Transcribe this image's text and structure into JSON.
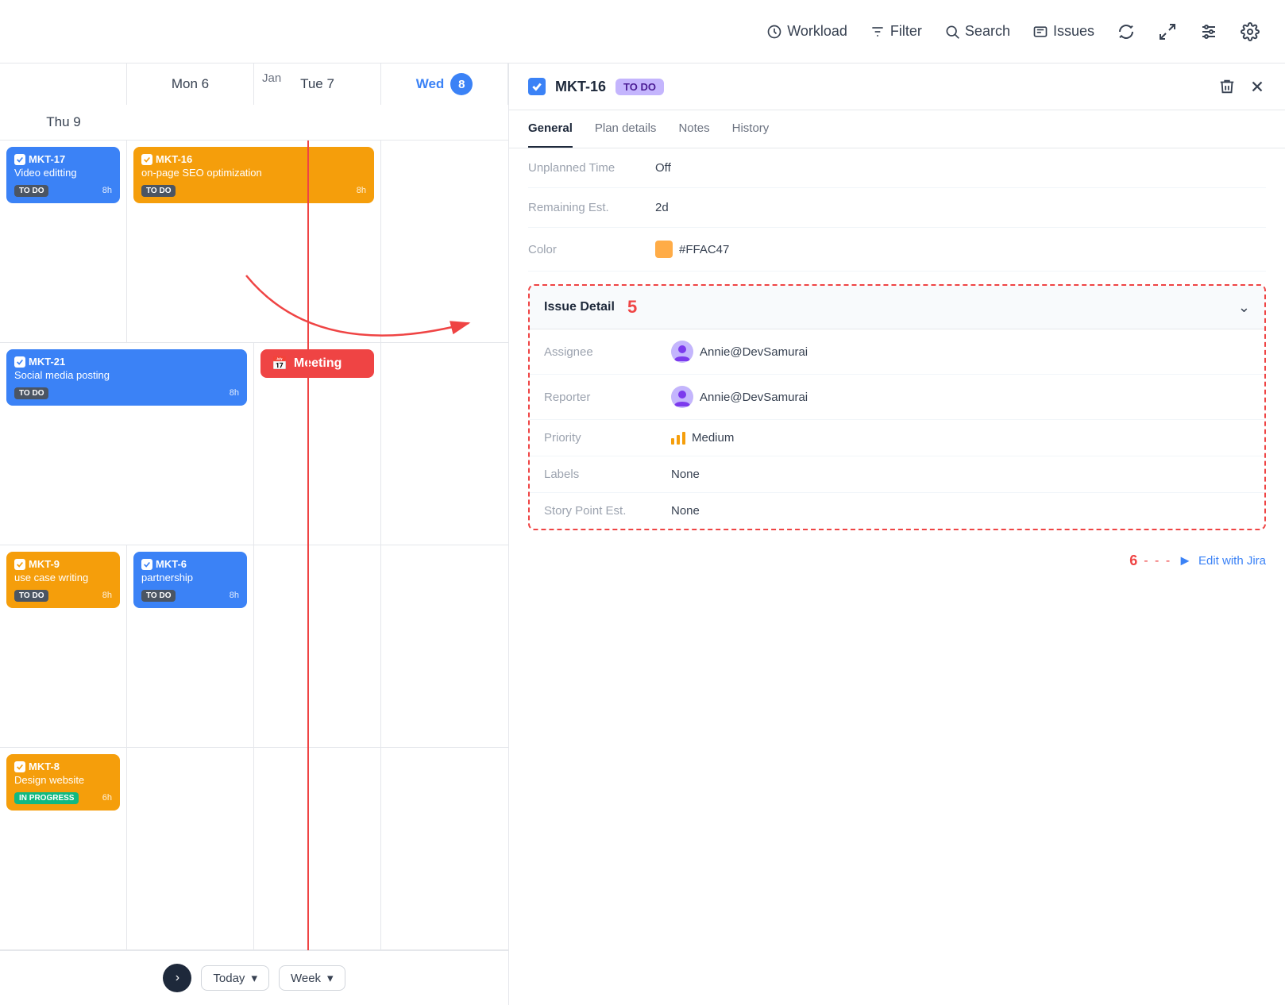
{
  "toolbar": {
    "workload_label": "Workload",
    "filter_label": "Filter",
    "search_label": "Search",
    "issues_label": "Issues"
  },
  "calendar": {
    "month": "Jan",
    "days": [
      {
        "label": "Mon 6",
        "today": false
      },
      {
        "label": "Tue 7",
        "today": false
      },
      {
        "label": "Wed",
        "number": "8",
        "today": true
      },
      {
        "label": "Thu 9",
        "today": false
      }
    ],
    "nav": {
      "today_label": "Today",
      "week_label": "Week"
    }
  },
  "tasks": {
    "row1": {
      "col1": {
        "id": "MKT-17",
        "title": "Video editting",
        "status": "TO DO",
        "hours": "8h",
        "color": "blue"
      },
      "col2": {
        "id": "MKT-16",
        "title": "on-page SEO optimization",
        "status": "TO DO",
        "hours": "8h",
        "color": "orange",
        "span": 2
      }
    },
    "row2": {
      "col1_2": {
        "id": "MKT-21",
        "title": "Social media posting",
        "status": "TO DO",
        "hours": "8h",
        "color": "blue",
        "span": 2
      },
      "meeting": {
        "label": "Meeting"
      }
    },
    "row3": {
      "col1": {
        "id": "MKT-9",
        "title": "use case writing",
        "status": "TO DO",
        "hours": "8h",
        "color": "orange"
      },
      "col2": {
        "id": "MKT-6",
        "title": "partnership",
        "status": "TO DO",
        "hours": "8h",
        "color": "blue"
      }
    },
    "row4": {
      "col1": {
        "id": "MKT-8",
        "title": "Design website",
        "status": "IN PROGRESS",
        "hours": "6h",
        "color": "orange"
      }
    }
  },
  "detail": {
    "issue_id": "MKT-16",
    "status": "TO DO",
    "tabs": [
      "General",
      "Plan details",
      "Notes",
      "History"
    ],
    "active_tab": "General",
    "fields": [
      {
        "label": "Unplanned Time",
        "value": "Off"
      },
      {
        "label": "Remaining Est.",
        "value": "2d"
      },
      {
        "label": "Color",
        "value": "#FFAC47",
        "has_swatch": true
      }
    ],
    "issue_detail": {
      "title": "Issue Detail",
      "count": "5",
      "fields": [
        {
          "label": "Assignee",
          "value": "Annie@DevSamurai",
          "has_avatar": true
        },
        {
          "label": "Reporter",
          "value": "Annie@DevSamurai",
          "has_avatar": true
        },
        {
          "label": "Priority",
          "value": "Medium",
          "has_priority": true
        },
        {
          "label": "Labels",
          "value": "None"
        },
        {
          "label": "Story Point Est.",
          "value": "None"
        }
      ]
    },
    "edit_jira": {
      "number": "6",
      "label": "Edit with Jira"
    }
  }
}
